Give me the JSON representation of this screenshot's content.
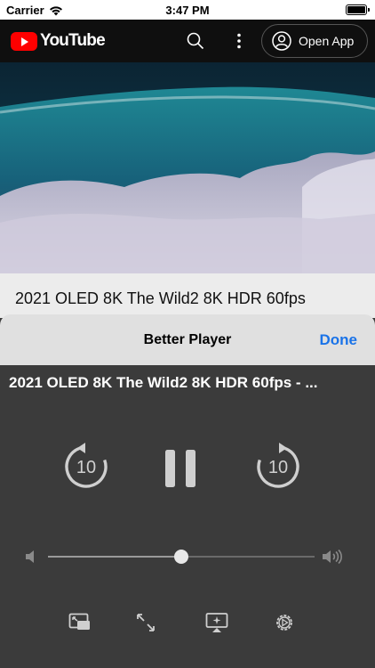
{
  "status_bar": {
    "carrier": "Carrier",
    "time": "3:47 PM"
  },
  "header": {
    "logo_text": "YouTube",
    "open_app_label": "Open App",
    "icons": [
      "search-icon",
      "more-vert-icon",
      "account-circle-icon"
    ]
  },
  "video": {
    "title": "2021 OLED 8K The Wild2 8K HDR 60fps"
  },
  "sheet": {
    "title": "Better Player",
    "done_label": "Done"
  },
  "player": {
    "title": "2021 OLED 8K The Wild2 8K HDR 60fps - ...",
    "rewind_seconds": "10",
    "forward_seconds": "10",
    "volume_level": 0.5,
    "icons": [
      "rewind-10-icon",
      "pause-icon",
      "forward-10-icon",
      "volume-low-icon",
      "volume-high-icon",
      "picture-in-picture-icon",
      "fullscreen-icon",
      "airplay-icon",
      "settings-icon"
    ]
  },
  "colors": {
    "youtube_red": "#ff0000",
    "done_blue": "#1a73e8",
    "player_bg": "#3b3b3b",
    "control_gray": "#cfcfcf"
  }
}
